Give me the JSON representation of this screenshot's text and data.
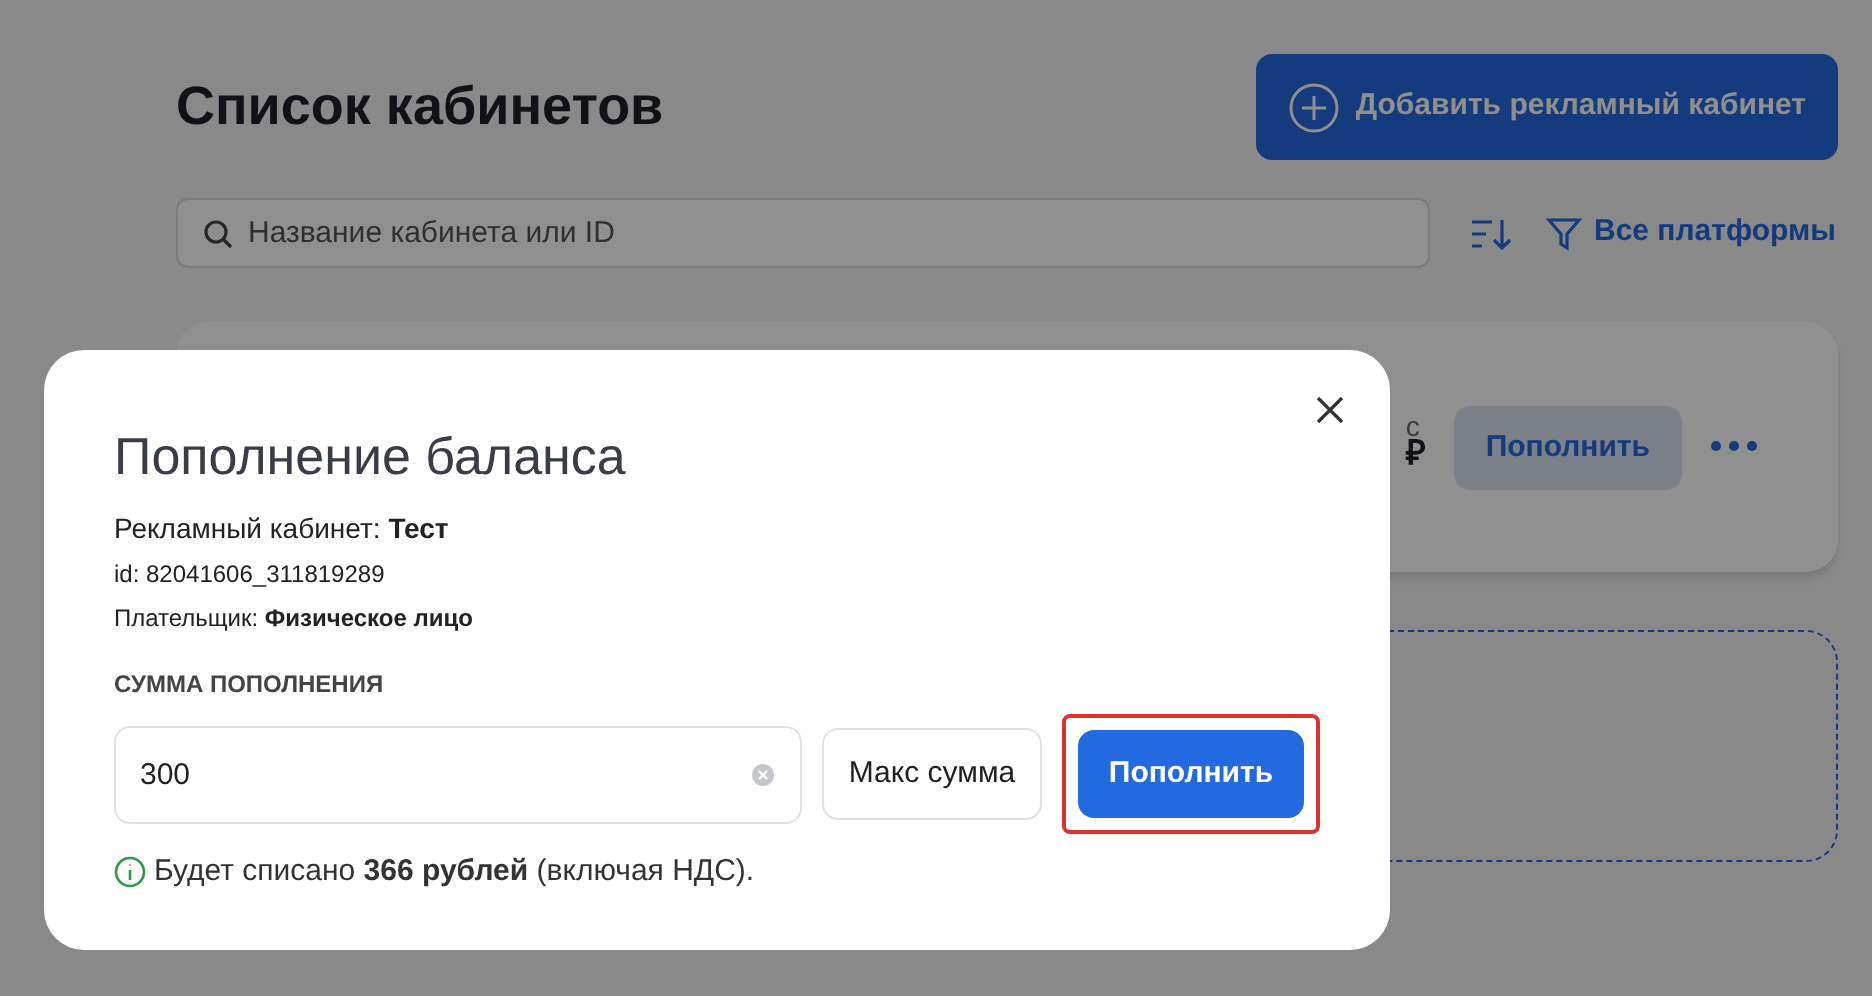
{
  "page": {
    "title": "Список кабинетов",
    "add_button": "Добавить рекламный кабинет",
    "search": {
      "placeholder": "Название кабинета или ID"
    },
    "filter": "Все платформы",
    "card": {
      "balance_label_fragment": "с",
      "balance_value_fragment": "₽",
      "topup_button": "Пополнить"
    }
  },
  "modal": {
    "title": "Пополнение баланса",
    "cabinet_label": "Рекламный кабинет: **Тест**",
    "id_line": "id: 82041606_311819289",
    "payer_line": "Плательщик: **Физическое лицо**",
    "amount_label": "СУММА ПОПОЛНЕНИЯ",
    "amount": {
      "value": "300"
    },
    "max_button": "Макс сумма",
    "submit": {
      "label": "Пополнить",
      "highlighted": true
    },
    "note": "Будет списано **366 рублей** (включая НДС)."
  }
}
